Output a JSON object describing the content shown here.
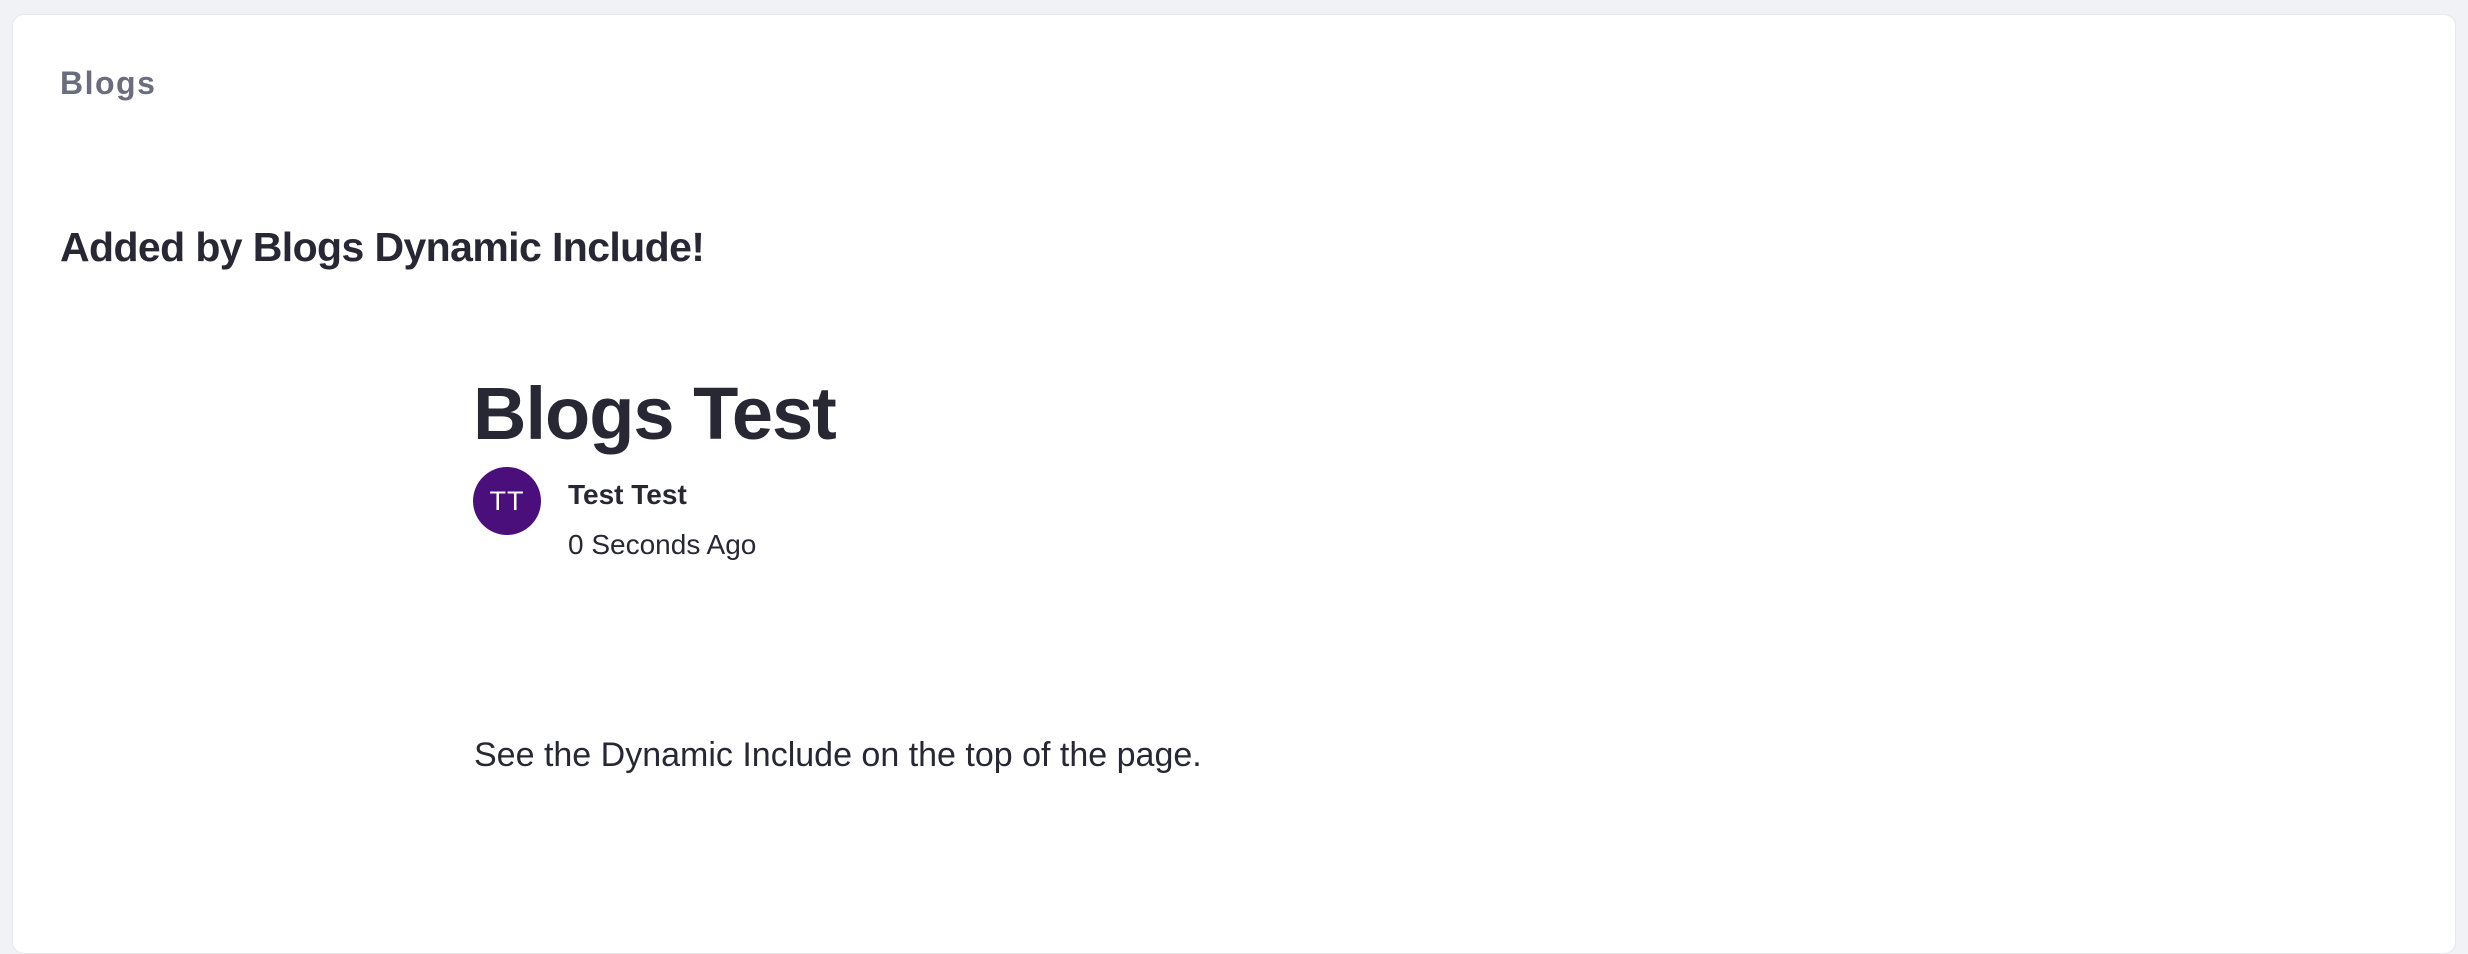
{
  "portlet": {
    "title": "Blogs"
  },
  "dynamic_include": {
    "text": "Added by Blogs Dynamic Include!"
  },
  "entry": {
    "title": "Blogs Test",
    "author": {
      "initials": "TT",
      "name": "Test Test",
      "avatar_color": "#4b0f7b"
    },
    "date": "0 Seconds Ago",
    "body": "See the Dynamic Include on the top of the page."
  }
}
